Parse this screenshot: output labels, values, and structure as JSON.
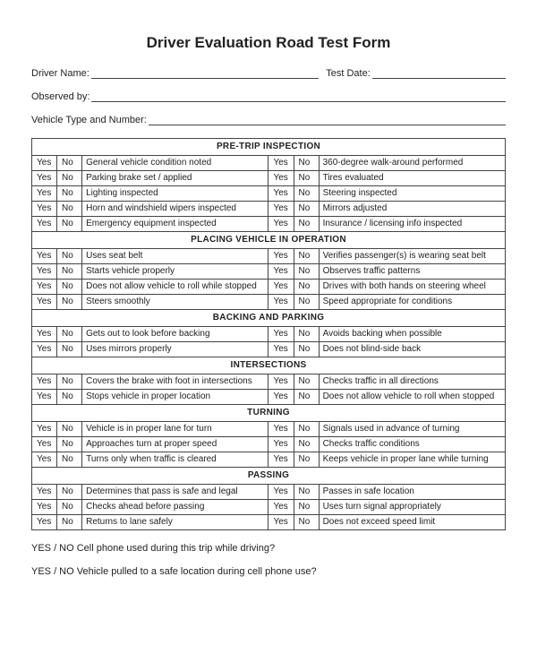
{
  "title": "Driver Evaluation Road Test Form",
  "fields": {
    "driver_name": "Driver Name:",
    "test_date": "Test Date:",
    "observed_by": "Observed by:",
    "vehicle": "Vehicle Type and Number:"
  },
  "yes": "Yes",
  "no": "No",
  "sections": [
    {
      "header": "PRE-TRIP INSPECTION",
      "rows": [
        [
          "General vehicle condition noted",
          "360-degree walk-around performed"
        ],
        [
          "Parking brake set / applied",
          "Tires evaluated"
        ],
        [
          "Lighting inspected",
          "Steering inspected"
        ],
        [
          "Horn and windshield wipers inspected",
          "Mirrors adjusted"
        ],
        [
          "Emergency equipment inspected",
          "Insurance / licensing info inspected"
        ]
      ]
    },
    {
      "header": "PLACING VEHICLE IN OPERATION",
      "rows": [
        [
          "Uses seat belt",
          "Verifies passenger(s) is wearing seat belt"
        ],
        [
          "Starts vehicle properly",
          "Observes traffic patterns"
        ],
        [
          "Does not allow vehicle to roll while stopped",
          "Drives with both hands on steering wheel"
        ],
        [
          "Steers smoothly",
          "Speed appropriate for conditions"
        ]
      ]
    },
    {
      "header": "BACKING AND PARKING",
      "rows": [
        [
          "Gets out to look before backing",
          "Avoids backing when possible"
        ],
        [
          "Uses mirrors properly",
          "Does not blind-side back"
        ]
      ]
    },
    {
      "header": "INTERSECTIONS",
      "rows": [
        [
          "Covers the brake with foot in intersections",
          "Checks traffic in all directions"
        ],
        [
          "Stops vehicle in proper location",
          "Does not allow vehicle to roll when stopped"
        ]
      ]
    },
    {
      "header": "TURNING",
      "rows": [
        [
          "Vehicle is in proper lane for turn",
          "Signals used in advance of turning"
        ],
        [
          "Approaches turn at proper speed",
          "Checks traffic conditions"
        ],
        [
          "Turns only when traffic is cleared",
          "Keeps vehicle in proper lane while turning"
        ]
      ]
    },
    {
      "header": "PASSING",
      "rows": [
        [
          "Determines that pass is safe and legal",
          "Passes in safe location"
        ],
        [
          "Checks ahead before passing",
          "Uses turn signal appropriately"
        ],
        [
          "Returns to lane safely",
          "Does not exceed speed limit"
        ]
      ]
    }
  ],
  "footer_questions": {
    "q1": "YES  /  NO  Cell phone used during this trip while driving?",
    "q2": "YES  /  NO  Vehicle pulled to a safe location during cell phone use?"
  }
}
